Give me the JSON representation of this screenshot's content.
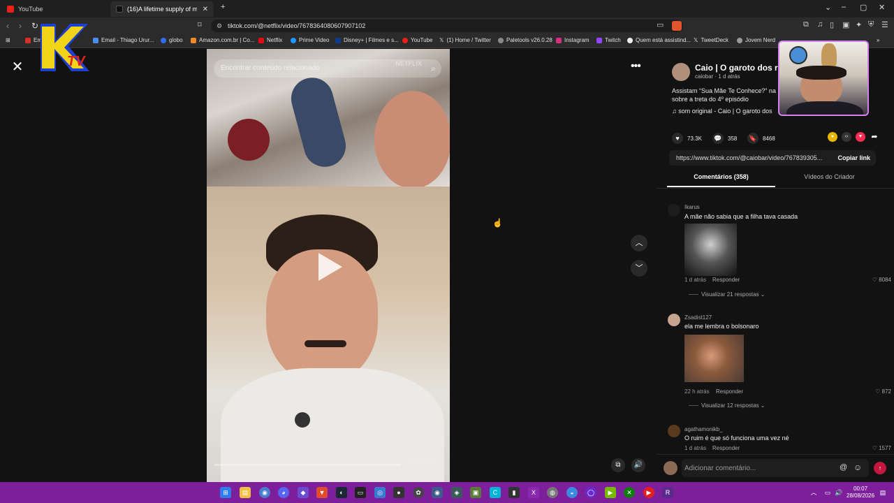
{
  "browser": {
    "tabs": [
      {
        "label": "YouTube",
        "active": false
      },
      {
        "label": "(16)A lifetime supply of mone",
        "active": true
      }
    ],
    "url": "tiktok.com/@netflix/video/7678364080607907102",
    "bookmarks": [
      "Em",
      "Email - Thiago Urur...",
      "globo",
      "Amazon.com.br | Co...",
      "Netflix",
      "Prime Video",
      "Disney+ | Filmes e s...",
      "YouTube",
      "(1) Home / Twitter",
      "Paletools v26.0.28",
      "Instagram",
      "Twitch",
      "Quem está assistind...",
      "TweetDeck",
      "Jovem Nerd"
    ]
  },
  "video": {
    "search_placeholder": "Encontrar conteúdo relacionado",
    "watermark": "NETFLIX",
    "time": "00:00/02:00",
    "progress": 0
  },
  "creator": {
    "name": "Caio | O garoto dos re",
    "sub": "caiobar · 1 d atrás",
    "desc_line1": "Assistam “Sua Mãe Te Conhece?” na",
    "desc_line2": "sobre a treta do 4º episódio",
    "music": "som original - Caio | O garoto dos"
  },
  "stats": {
    "likes": "73.3K",
    "comments": "358",
    "saves": "8468"
  },
  "link": {
    "url": "https://www.tiktok.com/@caiobar/video/767839305...",
    "copy_label": "Copiar link"
  },
  "tabs": {
    "comments": "Comentários (358)",
    "videos": "Vídeos do Criador"
  },
  "comments": [
    {
      "user": "Ikarus",
      "text": "A mãe não sabia que a filha tava casada",
      "time": "1 d atrás",
      "reply": "Responder",
      "likes": "8084",
      "replies": "Visualizar 21 respostas"
    },
    {
      "user": "Zsadist127",
      "text": "ela me lembra o bolsonaro",
      "time": "22 h atrás",
      "reply": "Responder",
      "likes": "872",
      "replies": "Visualizar 12 respostas"
    },
    {
      "user": "agathamonikb_",
      "text": "O ruim é que só funciona uma vez né",
      "time": "1 d atrás",
      "reply": "Responder",
      "likes": "1577"
    }
  ],
  "comment_input": {
    "placeholder": "Adicionar comentário..."
  },
  "overlay": {
    "logo_text": "KTV"
  },
  "taskbar": {
    "time": "00:07",
    "date": "28/08/2026"
  },
  "colors": {
    "accent": "#fe2c55",
    "taskbar": "#7d1f9a",
    "webcam_border": "#d57ff0"
  }
}
